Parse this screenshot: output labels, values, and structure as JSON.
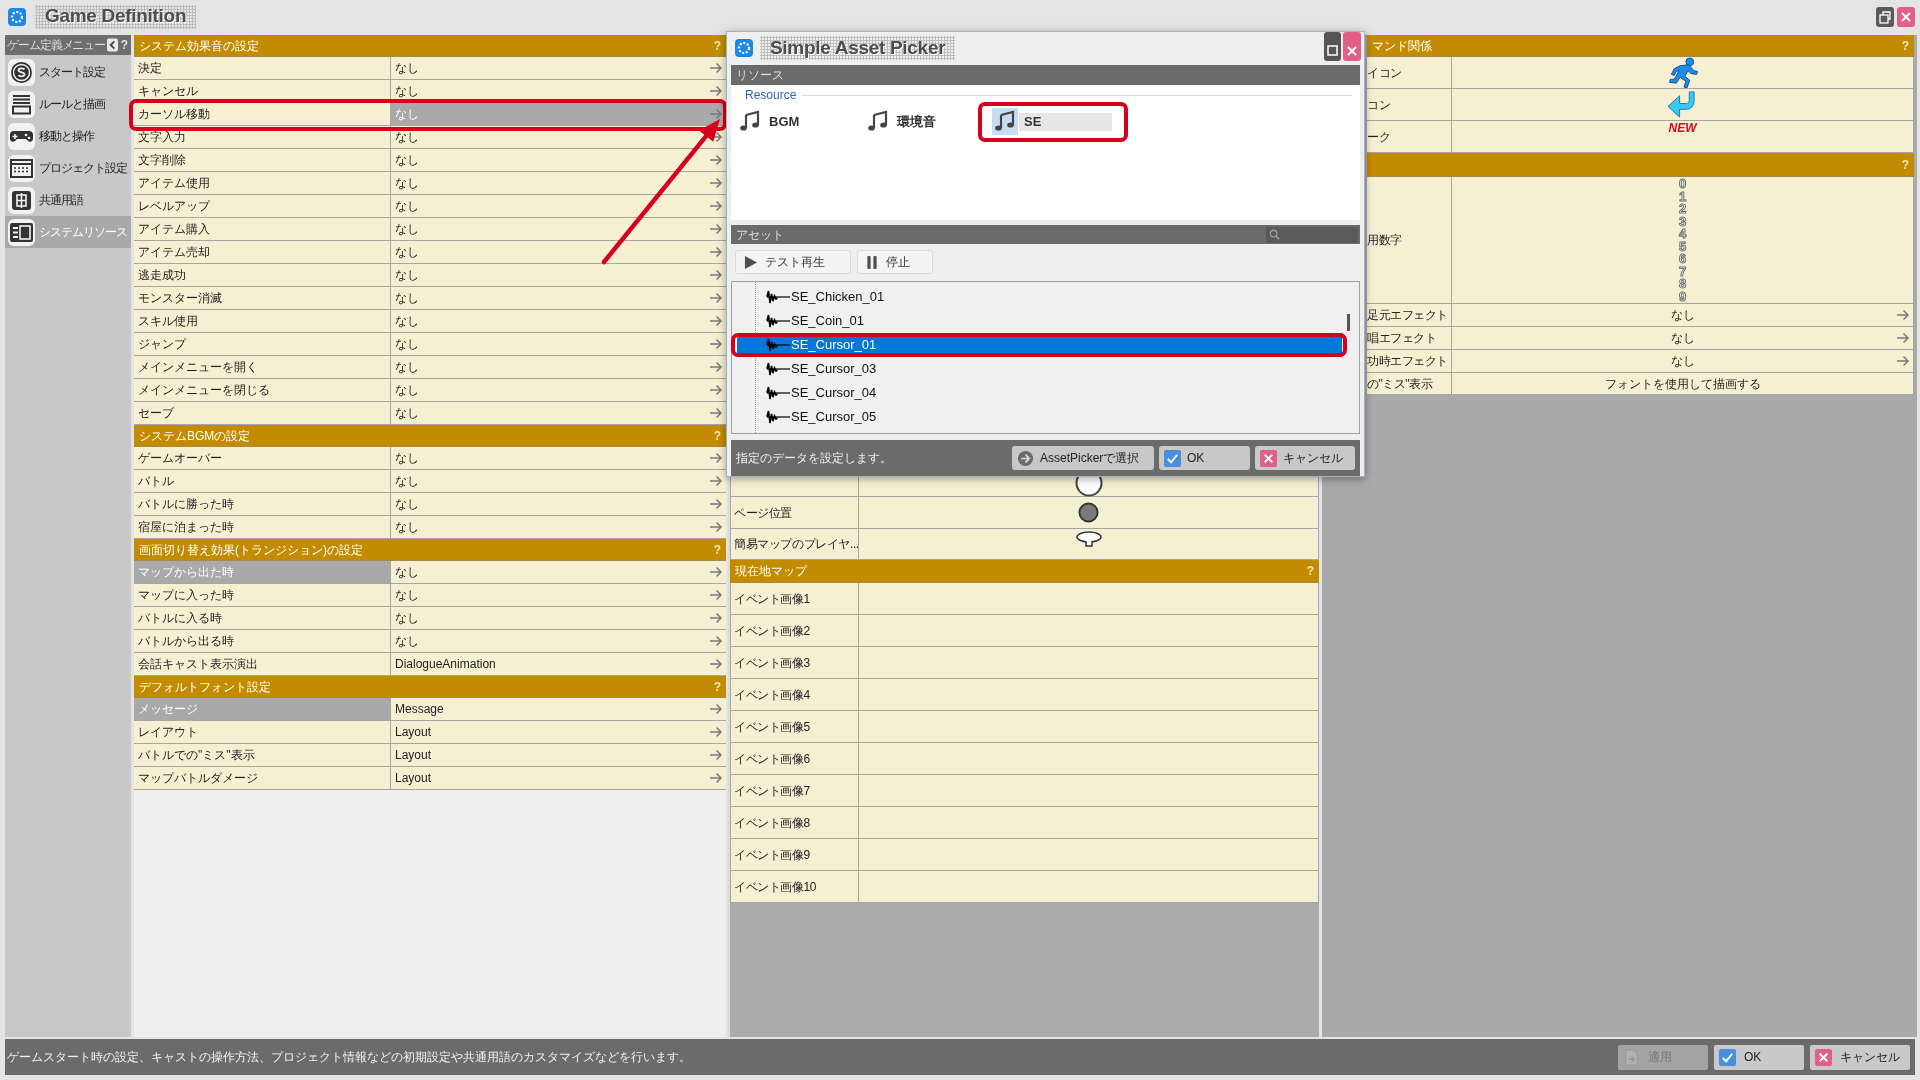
{
  "window": {
    "title": "Game Definition"
  },
  "sidebar": {
    "title": "ゲーム定義メニュー",
    "help": "?",
    "items": [
      {
        "label": "スタート設定",
        "selected": false
      },
      {
        "label": "ルールと描画",
        "selected": false
      },
      {
        "label": "移動と操作",
        "selected": false
      },
      {
        "label": "プロジェクト設定",
        "selected": false
      },
      {
        "label": "共通用語",
        "selected": false
      },
      {
        "label": "システムリソース",
        "selected": true
      }
    ]
  },
  "settings": {
    "sections": [
      {
        "title": "システム効果音の設定",
        "help": "?",
        "rows": [
          {
            "label": {
              "text": "決定",
              "selected": false
            },
            "value": {
              "text": "なし",
              "selected": false
            }
          },
          {
            "label": {
              "text": "キャンセル",
              "selected": false
            },
            "value": {
              "text": "なし",
              "selected": false
            }
          },
          {
            "label": {
              "text": "カーソル移動",
              "selected": false
            },
            "value": {
              "text": "なし",
              "selected": true
            },
            "annotated": true,
            "arrow_annotation": true
          },
          {
            "label": {
              "text": "文字入力",
              "selected": false
            },
            "value": {
              "text": "なし",
              "selected": false
            }
          },
          {
            "label": {
              "text": "文字削除",
              "selected": false
            },
            "value": {
              "text": "なし",
              "selected": false
            }
          },
          {
            "label": {
              "text": "アイテム使用",
              "selected": false
            },
            "value": {
              "text": "なし",
              "selected": false
            }
          },
          {
            "label": {
              "text": "レベルアップ",
              "selected": false
            },
            "value": {
              "text": "なし",
              "selected": false
            }
          },
          {
            "label": {
              "text": "アイテム購入",
              "selected": false
            },
            "value": {
              "text": "なし",
              "selected": false
            }
          },
          {
            "label": {
              "text": "アイテム売却",
              "selected": false
            },
            "value": {
              "text": "なし",
              "selected": false
            }
          },
          {
            "label": {
              "text": "逃走成功",
              "selected": false
            },
            "value": {
              "text": "なし",
              "selected": false
            }
          },
          {
            "label": {
              "text": "モンスター消滅",
              "selected": false
            },
            "value": {
              "text": "なし",
              "selected": false
            }
          },
          {
            "label": {
              "text": "スキル使用",
              "selected": false
            },
            "value": {
              "text": "なし",
              "selected": false
            }
          },
          {
            "label": {
              "text": "ジャンプ",
              "selected": false
            },
            "value": {
              "text": "なし",
              "selected": false
            }
          },
          {
            "label": {
              "text": "メインメニューを開く",
              "selected": false
            },
            "value": {
              "text": "なし",
              "selected": false
            }
          },
          {
            "label": {
              "text": "メインメニューを閉じる",
              "selected": false
            },
            "value": {
              "text": "なし",
              "selected": false
            }
          },
          {
            "label": {
              "text": "セーブ",
              "selected": false
            },
            "value": {
              "text": "なし",
              "selected": false
            }
          }
        ]
      },
      {
        "title": "システムBGMの設定",
        "help": "?",
        "rows": [
          {
            "label": {
              "text": "ゲームオーバー",
              "selected": false
            },
            "value": {
              "text": "なし",
              "selected": false
            }
          },
          {
            "label": {
              "text": "バトル",
              "selected": false
            },
            "value": {
              "text": "なし",
              "selected": false
            }
          },
          {
            "label": {
              "text": "バトルに勝った時",
              "selected": false
            },
            "value": {
              "text": "なし",
              "selected": false
            }
          },
          {
            "label": {
              "text": "宿屋に泊まった時",
              "selected": false
            },
            "value": {
              "text": "なし",
              "selected": false
            }
          }
        ]
      },
      {
        "title": "画面切り替え効果(トランジション)の設定",
        "help": "?",
        "rows": [
          {
            "label": {
              "text": "マップから出た時",
              "selected": true
            },
            "value": {
              "text": "なし",
              "selected": false
            }
          },
          {
            "label": {
              "text": "マップに入った時",
              "selected": false
            },
            "value": {
              "text": "なし",
              "selected": false
            }
          },
          {
            "label": {
              "text": "バトルに入る時",
              "selected": false
            },
            "value": {
              "text": "なし",
              "selected": false
            }
          },
          {
            "label": {
              "text": "バトルから出る時",
              "selected": false
            },
            "value": {
              "text": "なし",
              "selected": false
            }
          },
          {
            "label": {
              "text": "会話キャスト表示演出",
              "selected": false
            },
            "value": {
              "text": "DialogueAnimation",
              "selected": false
            }
          }
        ]
      },
      {
        "title": "デフォルトフォント設定",
        "help": "?",
        "rows": [
          {
            "label": {
              "text": "メッセージ",
              "selected": true
            },
            "value": {
              "text": "Message",
              "selected": false
            }
          },
          {
            "label": {
              "text": "レイアウト",
              "selected": false
            },
            "value": {
              "text": "Layout",
              "selected": false
            }
          },
          {
            "label": {
              "text": "バトルでの\"ミス\"表示",
              "selected": false
            },
            "value": {
              "text": "Layout",
              "selected": false
            }
          },
          {
            "label": {
              "text": "マップバトルダメージ",
              "selected": false
            },
            "value": {
              "text": "Layout",
              "selected": false
            }
          }
        ]
      }
    ]
  },
  "map_panel": {
    "sections": [
      {
        "rows": [
          {
            "kind": "image"
          },
          {
            "kind": "image",
            "label": "ページ位置"
          },
          {
            "kind": "image",
            "label": "簡易マップのプレイヤ..."
          }
        ]
      },
      {
        "title": "現在地マップ",
        "help": "?",
        "rows": [
          {
            "kind": "empty",
            "label": "イベント画像1"
          },
          {
            "kind": "empty",
            "label": "イベント画像2"
          },
          {
            "kind": "empty",
            "label": "イベント画像3"
          },
          {
            "kind": "empty",
            "label": "イベント画像4"
          },
          {
            "kind": "empty",
            "label": "イベント画像5"
          },
          {
            "kind": "empty",
            "label": "イベント画像6"
          },
          {
            "kind": "empty",
            "label": "イベント画像7"
          },
          {
            "kind": "empty",
            "label": "イベント画像8"
          },
          {
            "kind": "empty",
            "label": "イベント画像9"
          },
          {
            "kind": "empty",
            "label": "イベント画像10"
          }
        ]
      }
    ]
  },
  "command_panel": {
    "sections": [
      {
        "title": "マンド関係",
        "help": "?",
        "rows": [
          {
            "kind": "image",
            "label": "イコン"
          },
          {
            "kind": "image",
            "label": "コン"
          },
          {
            "kind": "mark",
            "label": "ーク",
            "value": "NEW"
          }
        ]
      },
      {
        "help": "?",
        "rows": [
          {
            "kind": "digits",
            "label": "用数字",
            "digits": [
              "0",
              "1",
              "2",
              "3",
              "4",
              "5",
              "6",
              "7",
              "8",
              "9"
            ]
          },
          {
            "kind": "picker",
            "label": "足元エフェクト",
            "value": "なし"
          },
          {
            "kind": "picker",
            "label": "唱エフェクト",
            "value": "なし"
          },
          {
            "kind": "picker",
            "label": "功時エフェクト",
            "value": "なし"
          },
          {
            "kind": "text",
            "label": "の\"ミス\"表示",
            "value": "フォントを使用して描画する"
          }
        ]
      }
    ]
  },
  "asset_picker": {
    "title": "Simple Asset Picker",
    "resources": {
      "title": "リソース",
      "group": "Resource",
      "types": [
        {
          "label": "BGM",
          "selected": false
        },
        {
          "label": "環境音",
          "selected": false
        },
        {
          "label": "SE",
          "selected": true,
          "annotated": true
        }
      ]
    },
    "assets": {
      "title": "アセット",
      "toolbar": [
        {
          "kind": "play",
          "label": "テスト再生"
        },
        {
          "kind": "stop",
          "label": "停止"
        }
      ],
      "items": [
        {
          "name": "SE_Chicken_01",
          "selected": false
        },
        {
          "name": "SE_Coin_01",
          "selected": false
        },
        {
          "name": "SE_Cursor_01",
          "selected": true,
          "annotated": true
        },
        {
          "name": "SE_Cursor_03",
          "selected": false
        },
        {
          "name": "SE_Cursor_04",
          "selected": false
        },
        {
          "name": "SE_Cursor_05",
          "selected": false
        }
      ]
    },
    "footer": {
      "message": "指定のデータを設定します。",
      "buttons": [
        {
          "kind": "browse",
          "label": "AssetPickerで選択"
        },
        {
          "kind": "ok",
          "label": "OK"
        },
        {
          "kind": "cancel",
          "label": "キャンセル"
        }
      ]
    }
  },
  "status_bar": {
    "message": "ゲームスタート時の設定、キャストの操作方法、プロジェクト情報などの初期設定や共通用語のカスタマイズなどを行います。",
    "buttons": [
      {
        "kind": "apply",
        "label": "適用",
        "disabled": true
      },
      {
        "kind": "ok",
        "label": "OK",
        "disabled": false
      },
      {
        "kind": "cancel",
        "label": "キャンセル",
        "disabled": false
      }
    ]
  }
}
